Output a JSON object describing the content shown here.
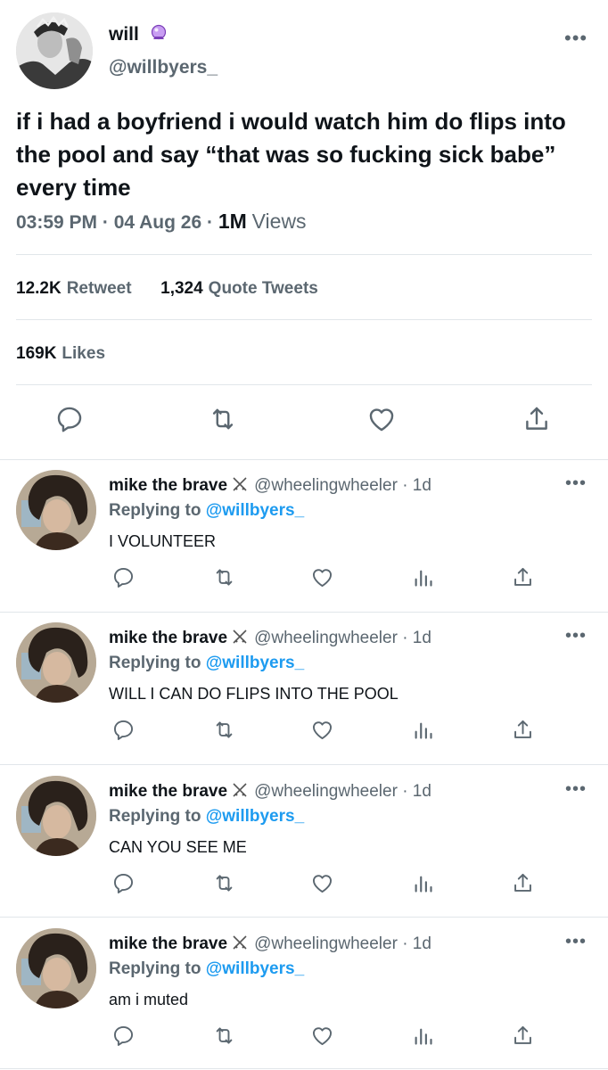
{
  "main_tweet": {
    "author_name": "will",
    "author_handle": "@willbyers_",
    "text": "if i had a boyfriend i would watch him do flips into the pool and say “that was so fucking sick babe” every time",
    "time": "03:59 PM",
    "date": "04 Aug 26",
    "views_count": "1M",
    "views_label": "Views",
    "retweets_count": "12.2K",
    "retweets_label": "Retweet",
    "quotes_count": "1,324",
    "quotes_label": "Quote Tweets",
    "likes_count": "169K",
    "likes_label": "Likes",
    "more": "•••",
    "badge_icon": "crystal-ball-icon",
    "actions": [
      "reply-icon",
      "retweet-icon",
      "like-icon",
      "share-icon"
    ]
  },
  "replies": [
    {
      "name": "mike the brave",
      "handle": "@wheelingwheeler",
      "dot": "·",
      "time": "1d",
      "replying_prefix": "Replying to",
      "replying_to": "@willbyers_",
      "text": "I VOLUNTEER",
      "more": "•••"
    },
    {
      "name": "mike the brave",
      "handle": "@wheelingwheeler",
      "dot": "·",
      "time": "1d",
      "replying_prefix": "Replying to",
      "replying_to": "@willbyers_",
      "text": "WILL I CAN DO FLIPS INTO THE POOL",
      "more": "•••"
    },
    {
      "name": "mike the brave",
      "handle": "@wheelingwheeler",
      "dot": "·",
      "time": "1d",
      "replying_prefix": "Replying to",
      "replying_to": "@willbyers_",
      "text": "CAN YOU SEE ME",
      "more": "•••"
    },
    {
      "name": "mike the brave",
      "handle": "@wheelingwheeler",
      "dot": "·",
      "time": "1d",
      "replying_prefix": "Replying to",
      "replying_to": "@willbyers_",
      "text": "am i muted",
      "more": "•••"
    }
  ],
  "colors": {
    "text": "#0f1419",
    "secondary": "#5b6770",
    "accent": "#1d9bf0",
    "divider": "#e1e6ea"
  }
}
